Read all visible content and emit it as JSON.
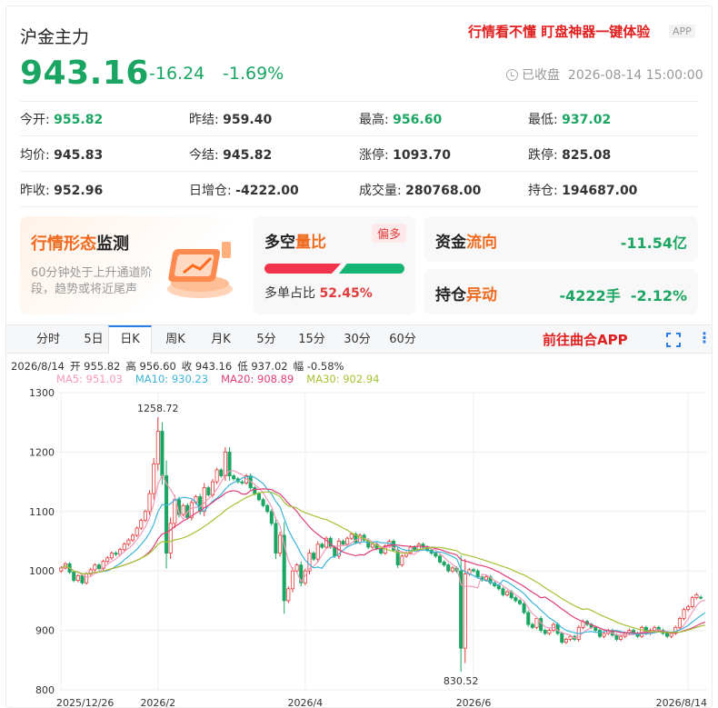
{
  "header": {
    "title": "沪金主力",
    "promo": "行情看不懂 盯盘神器一键体验",
    "app_badge": "APP",
    "price": "943.16",
    "change": "-16.24",
    "change_pct": "-1.69%",
    "status": "已收盘",
    "datetime": "2026-08-14 15:00:00"
  },
  "colors": {
    "up": "#e23b3b",
    "down": "#1aa562",
    "accent": "#2a7de1",
    "promo": "#e02020"
  },
  "stats": [
    {
      "label": "今开:",
      "value": "955.82",
      "color": "green"
    },
    {
      "label": "昨结:",
      "value": "959.40",
      "color": "black"
    },
    {
      "label": "最高:",
      "value": "956.60",
      "color": "green"
    },
    {
      "label": "最低:",
      "value": "937.02",
      "color": "green"
    },
    {
      "label": "均价:",
      "value": "945.83",
      "color": "black"
    },
    {
      "label": "今结:",
      "value": "945.82",
      "color": "black"
    },
    {
      "label": "涨停:",
      "value": "1093.70",
      "color": "black"
    },
    {
      "label": "跌停:",
      "value": "825.08",
      "color": "black"
    },
    {
      "label": "昨收:",
      "value": "952.96",
      "color": "black"
    },
    {
      "label": "日增仓:",
      "value": "-4222.00",
      "color": "black"
    },
    {
      "label": "成交量:",
      "value": "280768.00",
      "color": "black"
    },
    {
      "label": "持仓:",
      "value": "194687.00",
      "color": "black"
    }
  ],
  "cards": {
    "pattern": {
      "title_a": "行情形态",
      "title_b": "监测",
      "desc": "60分钟处于上升通道阶段，趋势或将近尾声"
    },
    "ratio": {
      "title_a": "多空",
      "title_b": "量比",
      "tag": "偏多",
      "label": "多单占比",
      "value": "52.45%",
      "long_pct": 52.45
    },
    "flow": {
      "title_a": "资金",
      "title_b": "流向",
      "value": "-11.54亿"
    },
    "position": {
      "title_a": "持仓",
      "title_b": "异动",
      "value": "-4222手",
      "pct": "-2.12%"
    }
  },
  "tabs": [
    "分时",
    "5日",
    "日K",
    "周K",
    "月K",
    "5分",
    "15分",
    "30分",
    "60分"
  ],
  "active_tab": "日K",
  "goto_app": "前往曲合APP",
  "icons": {
    "fullscreen": "fullscreen-icon",
    "more": "more-vert-icon"
  },
  "bar_info": {
    "date": "2026/8/14",
    "open": "开 955.82",
    "high": "高 956.60",
    "close": "收 943.16",
    "low": "低 937.02",
    "amp": "幅 -0.58%"
  },
  "ma_info": [
    {
      "label": "MA5: 951.03",
      "color": "#f59ab8"
    },
    {
      "label": "MA10: 930.23",
      "color": "#3bb4d8"
    },
    {
      "label": "MA20: 908.89",
      "color": "#e0407a"
    },
    {
      "label": "MA30: 902.94",
      "color": "#a3c234"
    }
  ],
  "chart_data": {
    "type": "candlestick",
    "ylim": [
      800,
      1300
    ],
    "yticks": [
      800,
      900,
      1000,
      1100,
      1200,
      1300
    ],
    "xticks": [
      {
        "label": "2025/12/26",
        "index": 0
      },
      {
        "label": "2026/2",
        "index": 23
      },
      {
        "label": "2026/4",
        "index": 58
      },
      {
        "label": "2026/6",
        "index": 98
      },
      {
        "label": "2026/8/14",
        "index": 149
      }
    ],
    "annotations": [
      {
        "text": "1258.72",
        "index": 23,
        "value": 1258.72,
        "pos": "above"
      },
      {
        "text": "830.52",
        "index": 95,
        "value": 830.52,
        "pos": "below"
      }
    ],
    "close": [
      1005,
      1012,
      998,
      984,
      992,
      980,
      995,
      1002,
      1010,
      1004,
      1016,
      1022,
      1030,
      1028,
      1036,
      1045,
      1052,
      1060,
      1072,
      1085,
      1100,
      1130,
      1180,
      1235,
      1160,
      1030,
      1080,
      1120,
      1095,
      1110,
      1090,
      1115,
      1125,
      1100,
      1140,
      1128,
      1150,
      1170,
      1160,
      1200,
      1160,
      1155,
      1150,
      1148,
      1160,
      1140,
      1130,
      1120,
      1110,
      1100,
      1080,
      1030,
      1060,
      950,
      970,
      1000,
      1010,
      980,
      1000,
      1030,
      1020,
      1045,
      1040,
      1055,
      1040,
      1025,
      1050,
      1045,
      1055,
      1062,
      1048,
      1060,
      1052,
      1040,
      1045,
      1038,
      1030,
      1042,
      1050,
      1035,
      1010,
      1025,
      1030,
      1040,
      1035,
      1045,
      1040,
      1035,
      1030,
      1025,
      1015,
      1010,
      1000,
      1005,
      1000,
      870,
      995,
      1002,
      1000,
      990,
      985,
      990,
      980,
      975,
      970,
      960,
      965,
      955,
      950,
      945,
      930,
      910,
      905,
      920,
      900,
      895,
      900,
      910,
      895,
      880,
      885,
      890,
      885,
      905,
      915,
      910,
      905,
      900,
      890,
      895,
      900,
      892,
      885,
      890,
      895,
      900,
      895,
      890,
      905,
      895,
      900,
      905,
      900,
      895,
      890,
      895,
      905,
      920,
      935,
      940,
      955,
      960,
      955,
      943.16
    ],
    "open": [
      1000,
      1005,
      1012,
      998,
      984,
      992,
      980,
      995,
      1002,
      1010,
      1004,
      1016,
      1022,
      1030,
      1028,
      1036,
      1045,
      1052,
      1060,
      1072,
      1085,
      1100,
      1130,
      1180,
      1235,
      1160,
      1030,
      1080,
      1120,
      1095,
      1110,
      1090,
      1115,
      1125,
      1100,
      1140,
      1128,
      1150,
      1170,
      1160,
      1200,
      1160,
      1155,
      1150,
      1148,
      1160,
      1140,
      1130,
      1120,
      1110,
      1100,
      1080,
      1030,
      1060,
      950,
      970,
      1000,
      1010,
      980,
      1000,
      1030,
      1020,
      1045,
      1040,
      1055,
      1040,
      1025,
      1050,
      1045,
      1055,
      1062,
      1048,
      1060,
      1052,
      1040,
      1045,
      1038,
      1030,
      1042,
      1050,
      1035,
      1010,
      1025,
      1030,
      1040,
      1035,
      1045,
      1040,
      1035,
      1030,
      1025,
      1015,
      1010,
      1000,
      1005,
      1000,
      870,
      995,
      1002,
      1000,
      990,
      985,
      990,
      980,
      975,
      970,
      960,
      965,
      955,
      950,
      945,
      930,
      910,
      905,
      920,
      900,
      895,
      900,
      910,
      895,
      880,
      885,
      890,
      885,
      905,
      915,
      910,
      905,
      900,
      890,
      895,
      900,
      892,
      885,
      890,
      895,
      900,
      895,
      890,
      905,
      895,
      900,
      905,
      900,
      895,
      890,
      895,
      905,
      920,
      935,
      940,
      955,
      955.82
    ]
  }
}
